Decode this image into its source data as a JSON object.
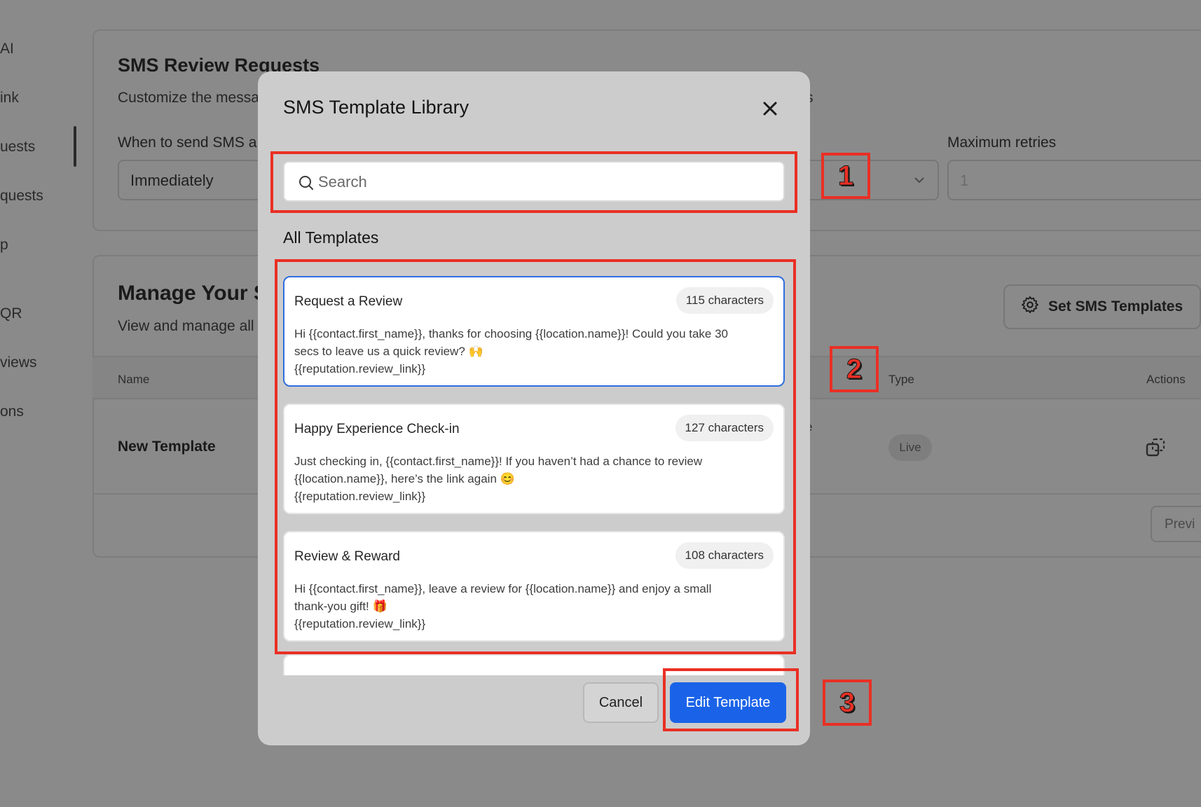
{
  "sidebar": {
    "items": [
      "AI",
      "ink",
      "uests",
      "quests",
      "p",
      "QR",
      "views",
      "ons"
    ]
  },
  "review_requests": {
    "title": "SMS Review Requests",
    "subtitle_left": "Customize the messa",
    "subtitle_right": "s",
    "when_label": "When to send SMS a",
    "when_value": "Immediately",
    "retries_label": "Maximum retries",
    "retries_value": "1"
  },
  "manage": {
    "title": "Manage Your S",
    "subtitle": "View and manage all",
    "set_button": "Set SMS Templates",
    "columns": {
      "name": "Name",
      "type": "Type",
      "actions": "Actions"
    },
    "row": {
      "name": "New Template",
      "type": "Live",
      "partial_char": "e"
    },
    "prev_button": "Previ"
  },
  "modal": {
    "title": "SMS Template Library",
    "search_placeholder": "Search",
    "section_title": "All Templates",
    "templates": [
      {
        "name": "Request a Review",
        "chars": "115 characters",
        "lines": [
          "Hi {{contact.first_name}}, thanks for choosing {{location.name}}! Could you take 30",
          "secs to leave us a quick review? 🙌",
          "{{reputation.review_link}}"
        ]
      },
      {
        "name": "Happy Experience Check-in",
        "chars": "127 characters",
        "lines": [
          "Just checking in, {{contact.first_name}}! If you haven’t had a chance to review",
          "{{location.name}}, here’s the link again 😊",
          "{{reputation.review_link}}"
        ]
      },
      {
        "name": "Review & Reward",
        "chars": "108 characters",
        "lines": [
          "Hi {{contact.first_name}}, leave a review for {{location.name}} and enjoy a small",
          "thank-you gift! 🎁",
          "{{reputation.review_link}}"
        ]
      }
    ],
    "cancel_label": "Cancel",
    "edit_label": "Edit Template"
  },
  "annotations": {
    "one": "1",
    "two": "2",
    "three": "3"
  },
  "colors": {
    "primary": "#1a63e8",
    "highlight": "#ea2f24",
    "selected_border": "#2f6ee0"
  },
  "icons": {
    "close": "close-icon",
    "search": "search-icon",
    "gear": "gear-icon",
    "copy": "copy-icon",
    "chevron": "chevron-down-icon"
  }
}
